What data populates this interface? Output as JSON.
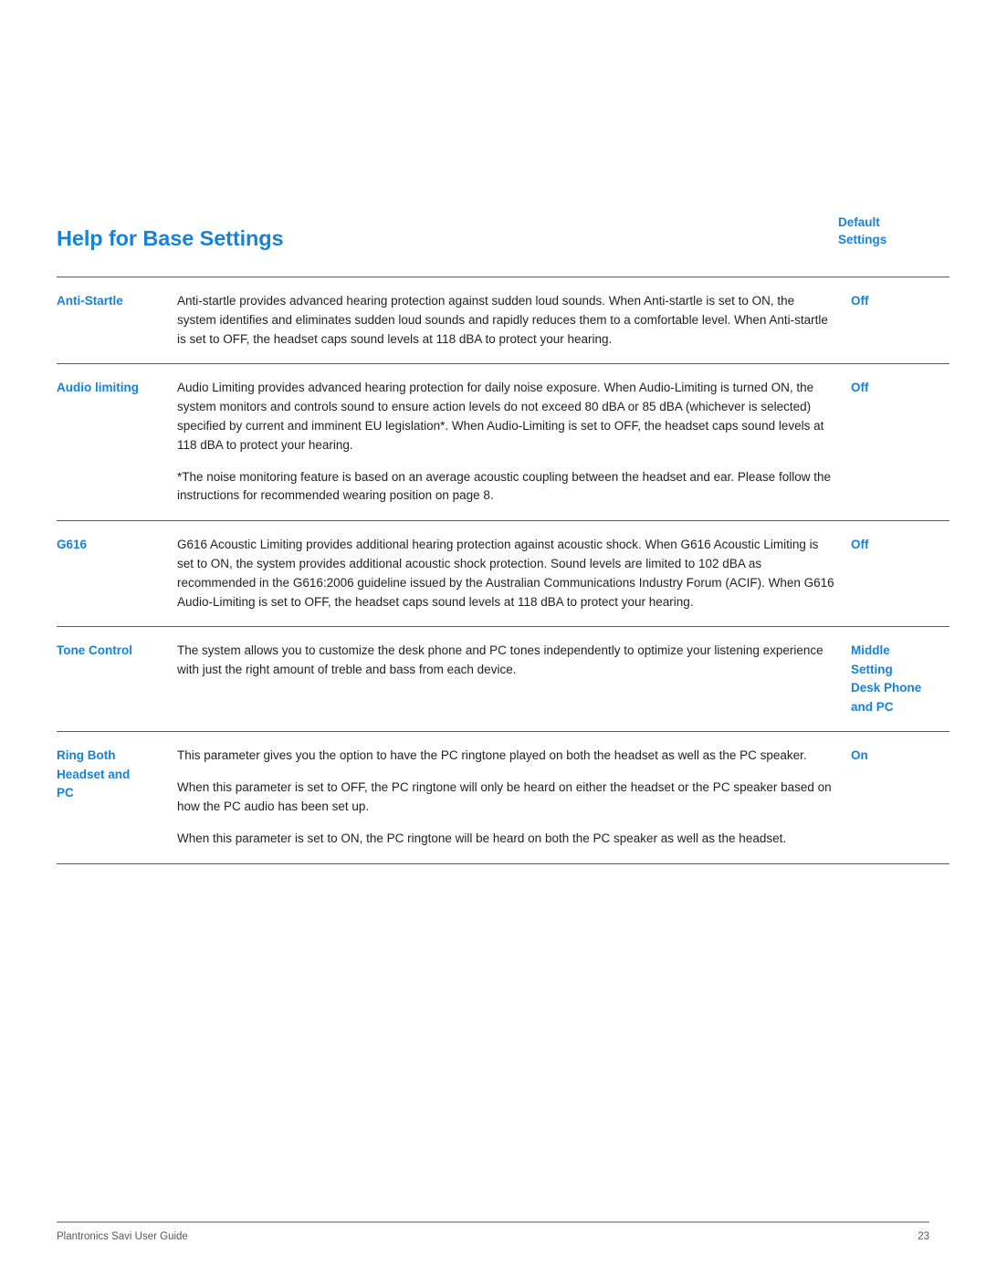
{
  "document": {
    "title": "Help for Base Settings",
    "default_settings_header": [
      "Default",
      "Settings"
    ]
  },
  "table": {
    "rows": [
      {
        "name_lines": [
          "Anti-Startle"
        ],
        "paragraphs": [
          "Anti-startle provides advanced hearing protection against sudden loud sounds. When Anti-startle is set to ON, the system identifies and eliminates sudden loud sounds and rapidly reduces them to a comfortable level. When Anti-startle is set to OFF, the headset caps sound levels at 118 dBA to protect your hearing."
        ],
        "default_lines": [
          "Off"
        ]
      },
      {
        "name_lines": [
          "Audio limiting"
        ],
        "paragraphs": [
          "Audio Limiting provides advanced hearing protection for daily noise exposure. When Audio-Limiting is turned ON, the system monitors and controls sound to ensure action levels do not exceed 80 dBA or 85 dBA (whichever is selected) specified by current and imminent EU legislation*. When Audio-Limiting is set to OFF, the headset caps sound levels at 118 dBA to protect your hearing.",
          "*The noise monitoring feature is based on an average acoustic coupling between the headset and ear. Please follow the instructions for recommended wearing position on page 8."
        ],
        "default_lines": [
          "Off"
        ]
      },
      {
        "name_lines": [
          "G616"
        ],
        "paragraphs": [
          "G616 Acoustic Limiting provides additional hearing protection against acoustic shock. When G616 Acoustic Limiting is set to ON, the system provides additional acoustic shock protection. Sound levels are limited to 102 dBA as recommended in the G616:2006 guideline issued by the Australian Communications Industry Forum (ACIF). When G616 Audio-Limiting is set to OFF, the headset caps sound levels at 118 dBA to protect your hearing."
        ],
        "default_lines": [
          "Off"
        ]
      },
      {
        "name_lines": [
          "Tone Control"
        ],
        "paragraphs": [
          "The system allows you to customize the desk phone and PC tones independently to optimize your listening experience with just the right amount of treble and bass from each device."
        ],
        "default_lines": [
          "Middle",
          "Setting",
          "Desk Phone",
          "and PC"
        ]
      },
      {
        "name_lines": [
          "Ring Both",
          "Headset and",
          "PC"
        ],
        "paragraphs": [
          "This parameter gives you the option to have the PC ringtone played on both the headset as well as the PC speaker.",
          "When this parameter is set to OFF, the PC ringtone will only be heard on either the headset or the PC speaker based on how the PC audio has been set up.",
          "When this parameter is set to ON, the PC ringtone will be heard on both the PC speaker as well as the headset."
        ],
        "default_lines": [
          "On"
        ]
      }
    ]
  },
  "footer": {
    "left": "Plantronics Savi User Guide",
    "page_number": "23"
  },
  "colors": {
    "accent_blue": "#1683d8",
    "body_text": "#231f20",
    "rule": "#58595b",
    "footer_rule": "#a7a9ac"
  }
}
